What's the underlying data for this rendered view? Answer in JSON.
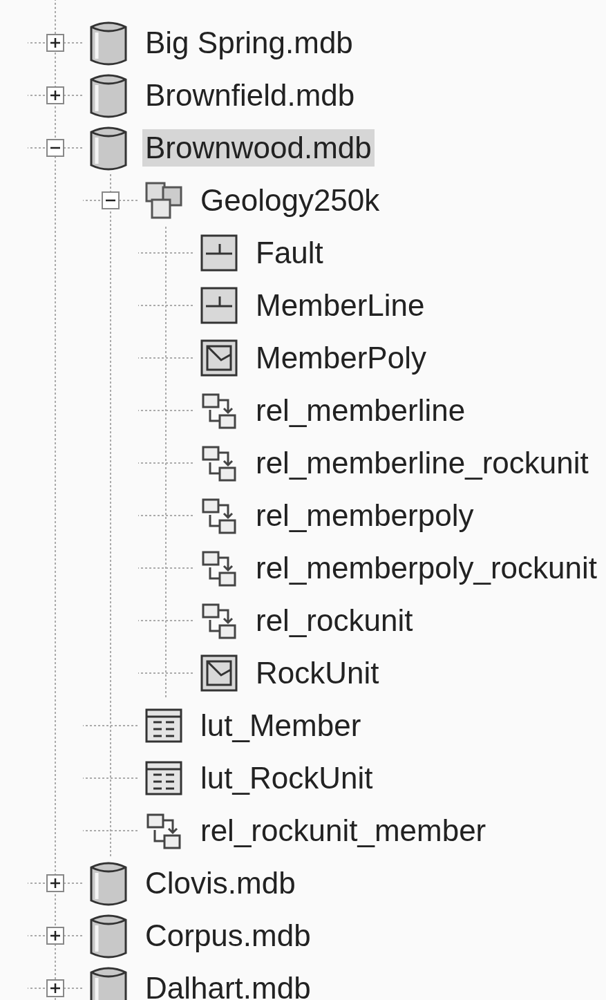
{
  "tree": [
    {
      "label": "Big Spring.mdb",
      "kind": "database",
      "expanded": false,
      "selected": false
    },
    {
      "label": "Brownfield.mdb",
      "kind": "database",
      "expanded": false,
      "selected": false
    },
    {
      "label": "Brownwood.mdb",
      "kind": "database",
      "expanded": true,
      "selected": true,
      "children": [
        {
          "label": "Geology250k",
          "kind": "dataset",
          "expanded": true,
          "selected": false,
          "children": [
            {
              "label": "Fault",
              "kind": "line",
              "selected": false
            },
            {
              "label": "MemberLine",
              "kind": "line",
              "selected": false
            },
            {
              "label": "MemberPoly",
              "kind": "polygon",
              "selected": false
            },
            {
              "label": "rel_memberline",
              "kind": "relationship",
              "selected": false
            },
            {
              "label": "rel_memberline_rockunit",
              "kind": "relationship",
              "selected": false
            },
            {
              "label": "rel_memberpoly",
              "kind": "relationship",
              "selected": false
            },
            {
              "label": "rel_memberpoly_rockunit",
              "kind": "relationship",
              "selected": false
            },
            {
              "label": "rel_rockunit",
              "kind": "relationship",
              "selected": false
            },
            {
              "label": "RockUnit",
              "kind": "polygon",
              "selected": false
            }
          ]
        },
        {
          "label": "lut_Member",
          "kind": "table",
          "selected": false
        },
        {
          "label": "lut_RockUnit",
          "kind": "table",
          "selected": false
        },
        {
          "label": "rel_rockunit_member",
          "kind": "relationship",
          "selected": false
        }
      ]
    },
    {
      "label": "Clovis.mdb",
      "kind": "database",
      "expanded": false,
      "selected": false
    },
    {
      "label": "Corpus.mdb",
      "kind": "database",
      "expanded": false,
      "selected": false
    },
    {
      "label": "Dalhart.mdb",
      "kind": "database",
      "expanded": false,
      "selected": false
    }
  ]
}
